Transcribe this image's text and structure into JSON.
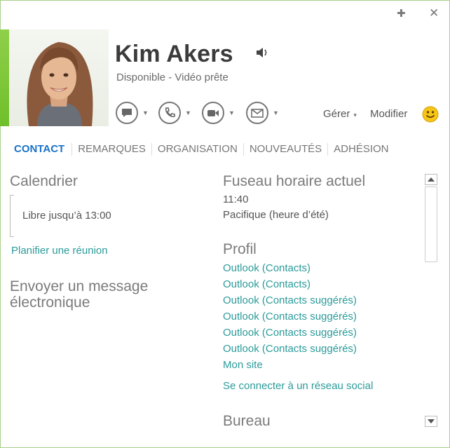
{
  "window": {
    "pin_glyph": "✚",
    "close_glyph": "✕"
  },
  "contact": {
    "name": "Kim Akers",
    "status": "Disponible - Vidéo prête",
    "presence_color": "#7cc63a"
  },
  "actions": [
    {
      "name": "im-icon"
    },
    {
      "name": "phone-icon"
    },
    {
      "name": "video-icon"
    },
    {
      "name": "email-icon"
    }
  ],
  "header": {
    "manage_label": "Gérer",
    "manage_caret": "▾",
    "edit_label": "Modifier"
  },
  "tabs": [
    "CONTACT",
    "REMARQUES",
    "ORGANISATION",
    "NOUVEAUTÉS",
    "ADHÉSION"
  ],
  "left": {
    "calendar_title": "Calendrier",
    "calendar_text": "Libre jusqu’à 13:00",
    "schedule_link": "Planifier une réunion",
    "send_email_title": "Envoyer un message électronique"
  },
  "right": {
    "timezone_title": "Fuseau horaire actuel",
    "time": "11:40",
    "zone": "Pacifique (heure d’été)",
    "profile_title": "Profil",
    "profile_links": [
      "Outlook (Contacts)",
      "Outlook (Contacts)",
      "Outlook (Contacts suggérés)",
      "Outlook (Contacts suggérés)",
      "Outlook (Contacts suggérés)",
      "Outlook (Contacts suggérés)",
      "Mon site"
    ],
    "social_link": "Se connecter à un réseau social",
    "office_title": "Bureau"
  },
  "colors": {
    "accent": "#1a73c8",
    "link": "#2c9b9a",
    "frame": "#a9cf8b"
  }
}
